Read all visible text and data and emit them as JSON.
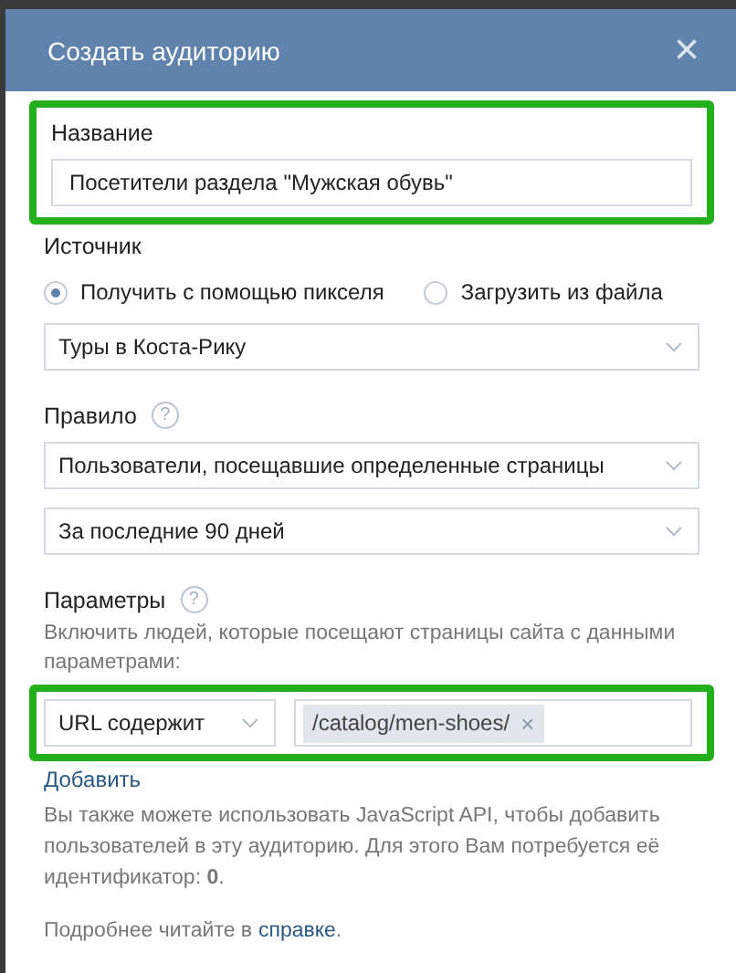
{
  "dialog": {
    "title": "Создать аудиторию",
    "close": "×"
  },
  "name_section": {
    "label": "Название",
    "value": "Посетители раздела \"Мужская обувь\"",
    "highlighted": true
  },
  "source": {
    "label": "Источник",
    "options": [
      {
        "label": "Получить с помощью пикселя",
        "selected": true
      },
      {
        "label": "Загрузить из файла",
        "selected": false
      }
    ],
    "pixel": "Туры в Коста-Рику"
  },
  "rule": {
    "label": "Правило",
    "help": "?",
    "selects": [
      "Пользователи, посещавшие определенные страницы",
      "За последние 90 дней"
    ]
  },
  "params": {
    "label": "Параметры",
    "help": "?",
    "description": "Включить людей, которые посещают страницы сайта с данными параметрами:",
    "condition": "URL содержит",
    "tags": [
      {
        "text": "/catalog/men-shoes/",
        "remove": "×"
      }
    ],
    "highlighted": true
  },
  "add_link": "Добавить",
  "info": "Вы также можете использовать JavaScript API, чтобы добавить пользователей в эту аудиторию. Для этого Вам потребуется её идентификатор: **0**.",
  "more": {
    "text": "Подробнее читайте в",
    "link": "справке",
    "tail": "."
  }
}
